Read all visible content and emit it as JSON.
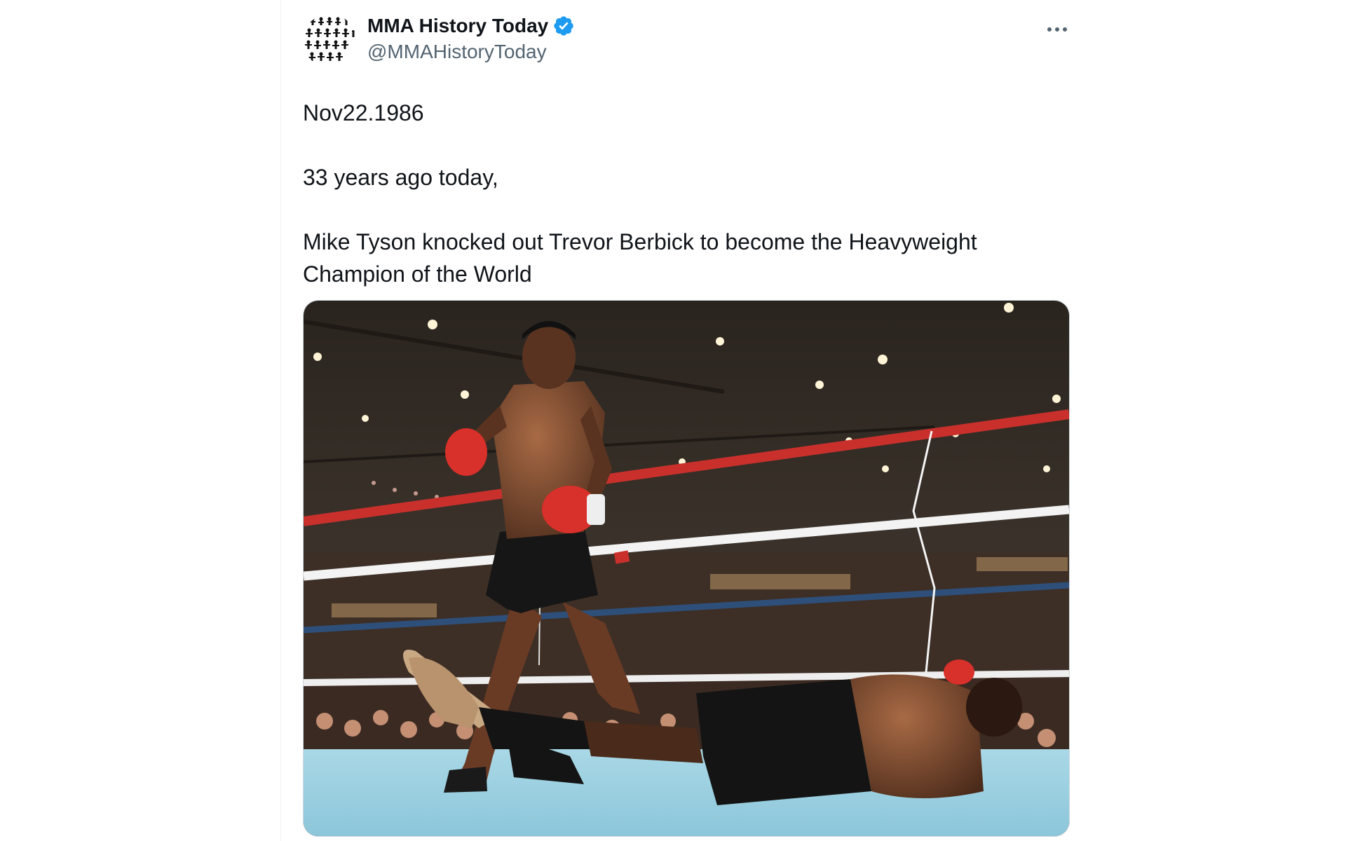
{
  "tweet": {
    "display_name": "MMA History Today",
    "handle": "@MMAHistoryToday",
    "verified": true,
    "more_icon": "more-horizontal-icon",
    "text_lines": [
      "Nov22.1986",
      "33 years ago today,",
      "Mike Tyson knocked out Trevor Berbick to become the Heavyweight Champion of the World"
    ],
    "media": {
      "type": "photo"
    }
  },
  "colors": {
    "accent": "#1d9bf0",
    "secondary_text": "#536471",
    "primary_text": "#0f1419"
  }
}
